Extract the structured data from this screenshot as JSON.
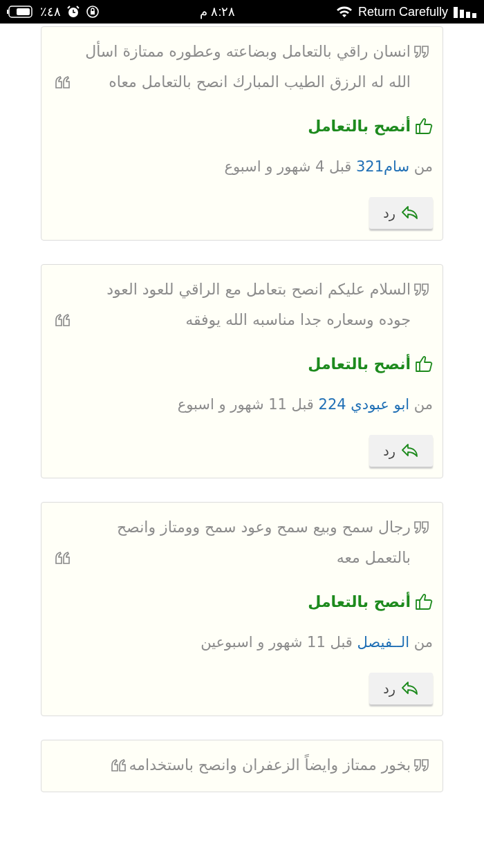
{
  "status_bar": {
    "battery": "٪٤٨",
    "time": "٨:٢٨ م",
    "carrier": "Return Carefully"
  },
  "reviews": [
    {
      "text": "انسان راقي بالتعامل وبضاعته وعطوره ممتازة اسأل الله له الرزق الطيب المبارك انصح بالتعامل معاه",
      "recommendation": "أنصح بالتعامل",
      "from_label": "من",
      "author": "سام321",
      "time": "قبل 4 شهور و اسبوع",
      "reply": "رد"
    },
    {
      "text": "السلام عليكم  انصح بتعامل مع الراقي للعود العود جوده وسعاره جدا مناسبه الله يوفقه",
      "recommendation": "أنصح بالتعامل",
      "from_label": "من",
      "author": "ابو عبودي 224",
      "time": "قبل 11 شهور و اسبوع",
      "reply": "رد"
    },
    {
      "text": "رجال سمح وبيع سمح وعود سمح وومتاز وانصح بالتعمل معه",
      "recommendation": "أنصح بالتعامل",
      "from_label": "من",
      "author": "الــفيصل",
      "time": "قبل 11 شهور و اسبوعين",
      "reply": "رد"
    },
    {
      "text": "بخور ممتاز وايضاً الزعفران وانصح باستخدامه"
    }
  ]
}
